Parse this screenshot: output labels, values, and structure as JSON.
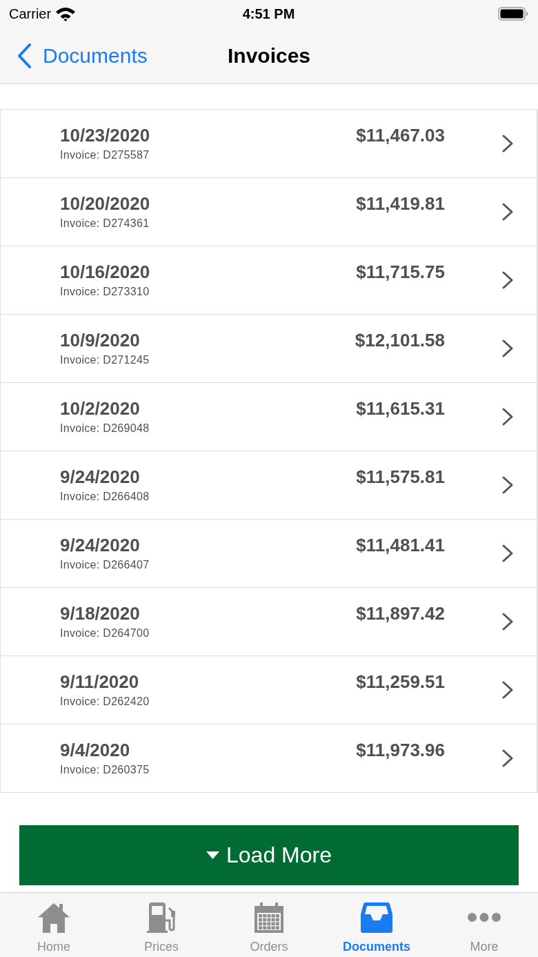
{
  "status_bar": {
    "carrier": "Carrier",
    "time": "4:51 PM"
  },
  "nav_bar": {
    "back_label": "Documents",
    "title": "Invoices"
  },
  "invoices": [
    {
      "date": "10/23/2020",
      "invoice": "Invoice: D275587",
      "amount": "$11,467.03"
    },
    {
      "date": "10/20/2020",
      "invoice": "Invoice: D274361",
      "amount": "$11,419.81"
    },
    {
      "date": "10/16/2020",
      "invoice": "Invoice: D273310",
      "amount": "$11,715.75"
    },
    {
      "date": "10/9/2020",
      "invoice": "Invoice: D271245",
      "amount": "$12,101.58"
    },
    {
      "date": "10/2/2020",
      "invoice": "Invoice: D269048",
      "amount": "$11,615.31"
    },
    {
      "date": "9/24/2020",
      "invoice": "Invoice: D266408",
      "amount": "$11,575.81"
    },
    {
      "date": "9/24/2020",
      "invoice": "Invoice: D266407",
      "amount": "$11,481.41"
    },
    {
      "date": "9/18/2020",
      "invoice": "Invoice: D264700",
      "amount": "$11,897.42"
    },
    {
      "date": "9/11/2020",
      "invoice": "Invoice: D262420",
      "amount": "$11,259.51"
    },
    {
      "date": "9/4/2020",
      "invoice": "Invoice: D260375",
      "amount": "$11,973.96"
    }
  ],
  "load_more": {
    "label": "Load More"
  },
  "tab_bar": [
    {
      "kind": "home",
      "label": "Home",
      "selected": false
    },
    {
      "kind": "prices",
      "label": "Prices",
      "selected": false
    },
    {
      "kind": "orders",
      "label": "Orders",
      "selected": false
    },
    {
      "kind": "documents",
      "label": "Documents",
      "selected": true
    },
    {
      "kind": "more",
      "label": "More",
      "selected": false
    }
  ]
}
